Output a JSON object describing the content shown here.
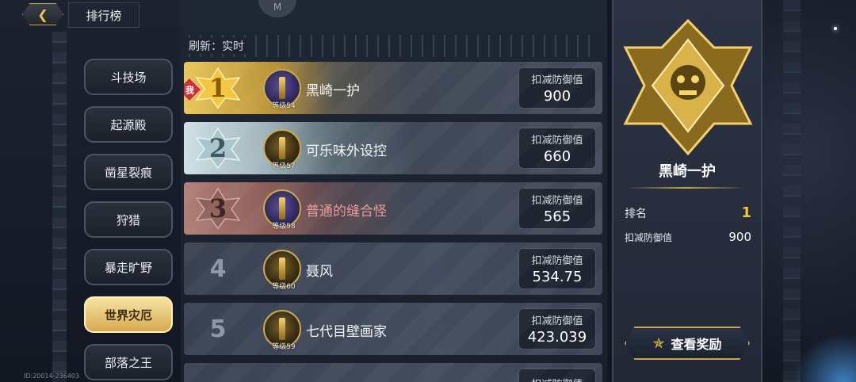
{
  "header": {
    "back_icon": "back-arrow-icon",
    "title": "排行榜"
  },
  "side_nav": {
    "items": [
      {
        "label": "斗技场",
        "active": false
      },
      {
        "label": "起源殿",
        "active": false
      },
      {
        "label": "凿星裂痕",
        "active": false
      },
      {
        "label": "狩猎",
        "active": false
      },
      {
        "label": "暴走旷野",
        "active": false
      },
      {
        "label": "世界灾厄",
        "active": true
      },
      {
        "label": "部落之王",
        "active": false
      }
    ]
  },
  "top_tab_label": "M",
  "refresh_label": "刷新：实时",
  "ranking": {
    "value_label": "扣减防御值",
    "me_tag": "我",
    "rows": [
      {
        "rank": "1",
        "name": "黑崎一护",
        "level": "等级54",
        "value": "900",
        "style": "gold"
      },
      {
        "rank": "2",
        "name": "可乐味外设控",
        "level": "等级57",
        "value": "660",
        "style": "silver"
      },
      {
        "rank": "3",
        "name": "普通的缝合怪",
        "level": "等级58",
        "value": "565",
        "style": "bronze"
      },
      {
        "rank": "4",
        "name": "聂风",
        "level": "等级60",
        "value": "534.75",
        "style": "plain"
      },
      {
        "rank": "5",
        "name": "七代目壁画家",
        "level": "等级59",
        "value": "423.039",
        "style": "plain"
      }
    ],
    "partial_label": "扣减防御值"
  },
  "my_info": {
    "name": "黑崎一护",
    "rank_label": "排名",
    "rank_value": "1",
    "value_label": "扣减防御值",
    "value": "900"
  },
  "reward_button": "查看奖励",
  "footer_id": "ID:20014-236403",
  "colors": {
    "gold": "#f5c542",
    "accent_border": "#c9a64a",
    "bronze_name": "#e79a95"
  }
}
